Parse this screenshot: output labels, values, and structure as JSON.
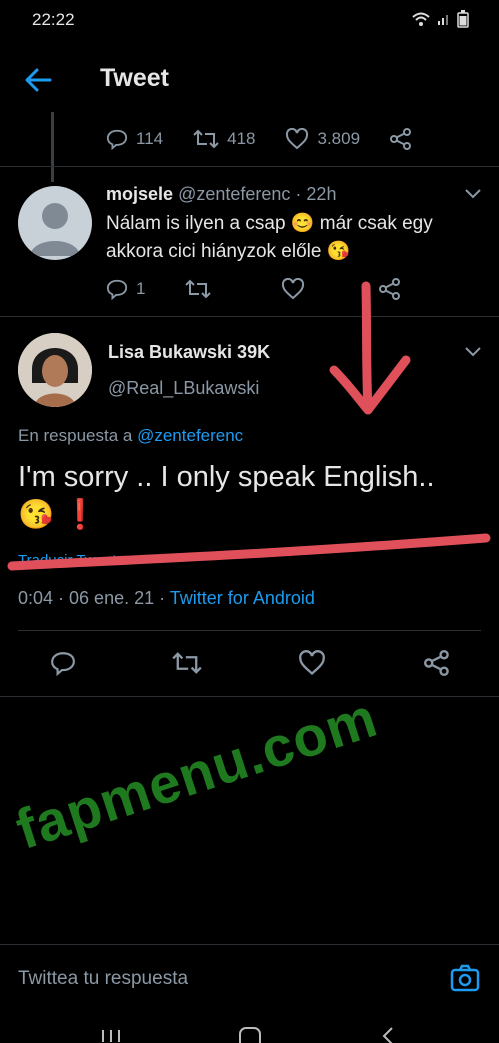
{
  "status_bar": {
    "time": "22:22"
  },
  "header": {
    "title": "Tweet"
  },
  "parent_actions": {
    "replies": "114",
    "retweets": "418",
    "likes": "3.809"
  },
  "reply_tweet": {
    "name": "mojsele",
    "handle": "@zenteferenc",
    "time": "· 22h",
    "text_part1": "Nálam is ilyen a csap",
    "emoji1": "😊",
    "text_part2": "már csak egy akkora cici hiányzok előle",
    "emoji2": "😘",
    "replies": "1"
  },
  "main_tweet": {
    "name": "Lisa Bukawski 39K",
    "handle": "@Real_LBukawski",
    "in_reply_prefix": "En respuesta a",
    "in_reply_mention": "@zenteferenc",
    "text": "I'm sorry .. I only speak English..",
    "emoji": "😘",
    "exclamation": "❗",
    "translate": "Traducir Tweet",
    "time_date": "0:04 · 06 ene. 21 ·",
    "app": "Twitter for Android"
  },
  "compose": {
    "placeholder": "Twittea tu respuesta"
  },
  "watermark": "fapmenu.com",
  "colors": {
    "accent": "#1d9bf0",
    "background": "#000000",
    "muted": "#8b98a5",
    "marker": "#e0505a",
    "watermark": "#1f7a1f"
  }
}
